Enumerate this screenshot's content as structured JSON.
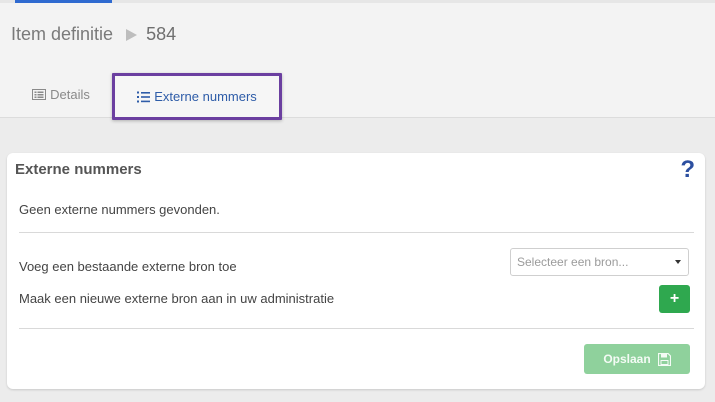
{
  "breadcrumb": {
    "section": "Item definitie",
    "id": "584"
  },
  "tabs": [
    {
      "label": "Details",
      "icon": "list-alt-icon",
      "active": false
    },
    {
      "label": "Externe nummers",
      "icon": "list-ol-icon",
      "active": true
    }
  ],
  "card": {
    "title": "Externe nummers",
    "help": "?",
    "empty_message": "Geen externe nummers gevonden.",
    "add_existing_label": "Voeg een bestaande externe bron toe",
    "select_placeholder": "Selecteer een bron...",
    "create_new_label": "Maak een nieuwe externe bron aan in uw administratie",
    "add_button_glyph": "+",
    "save_label": "Opslaan"
  },
  "colors": {
    "accent_blue": "#2f6ad0",
    "active_tab_text": "#2e5ca8",
    "highlight_border": "#6b3fa0",
    "add_button": "#2fa84f",
    "save_button": "#8fd19c",
    "help_icon": "#2c4fa0"
  }
}
